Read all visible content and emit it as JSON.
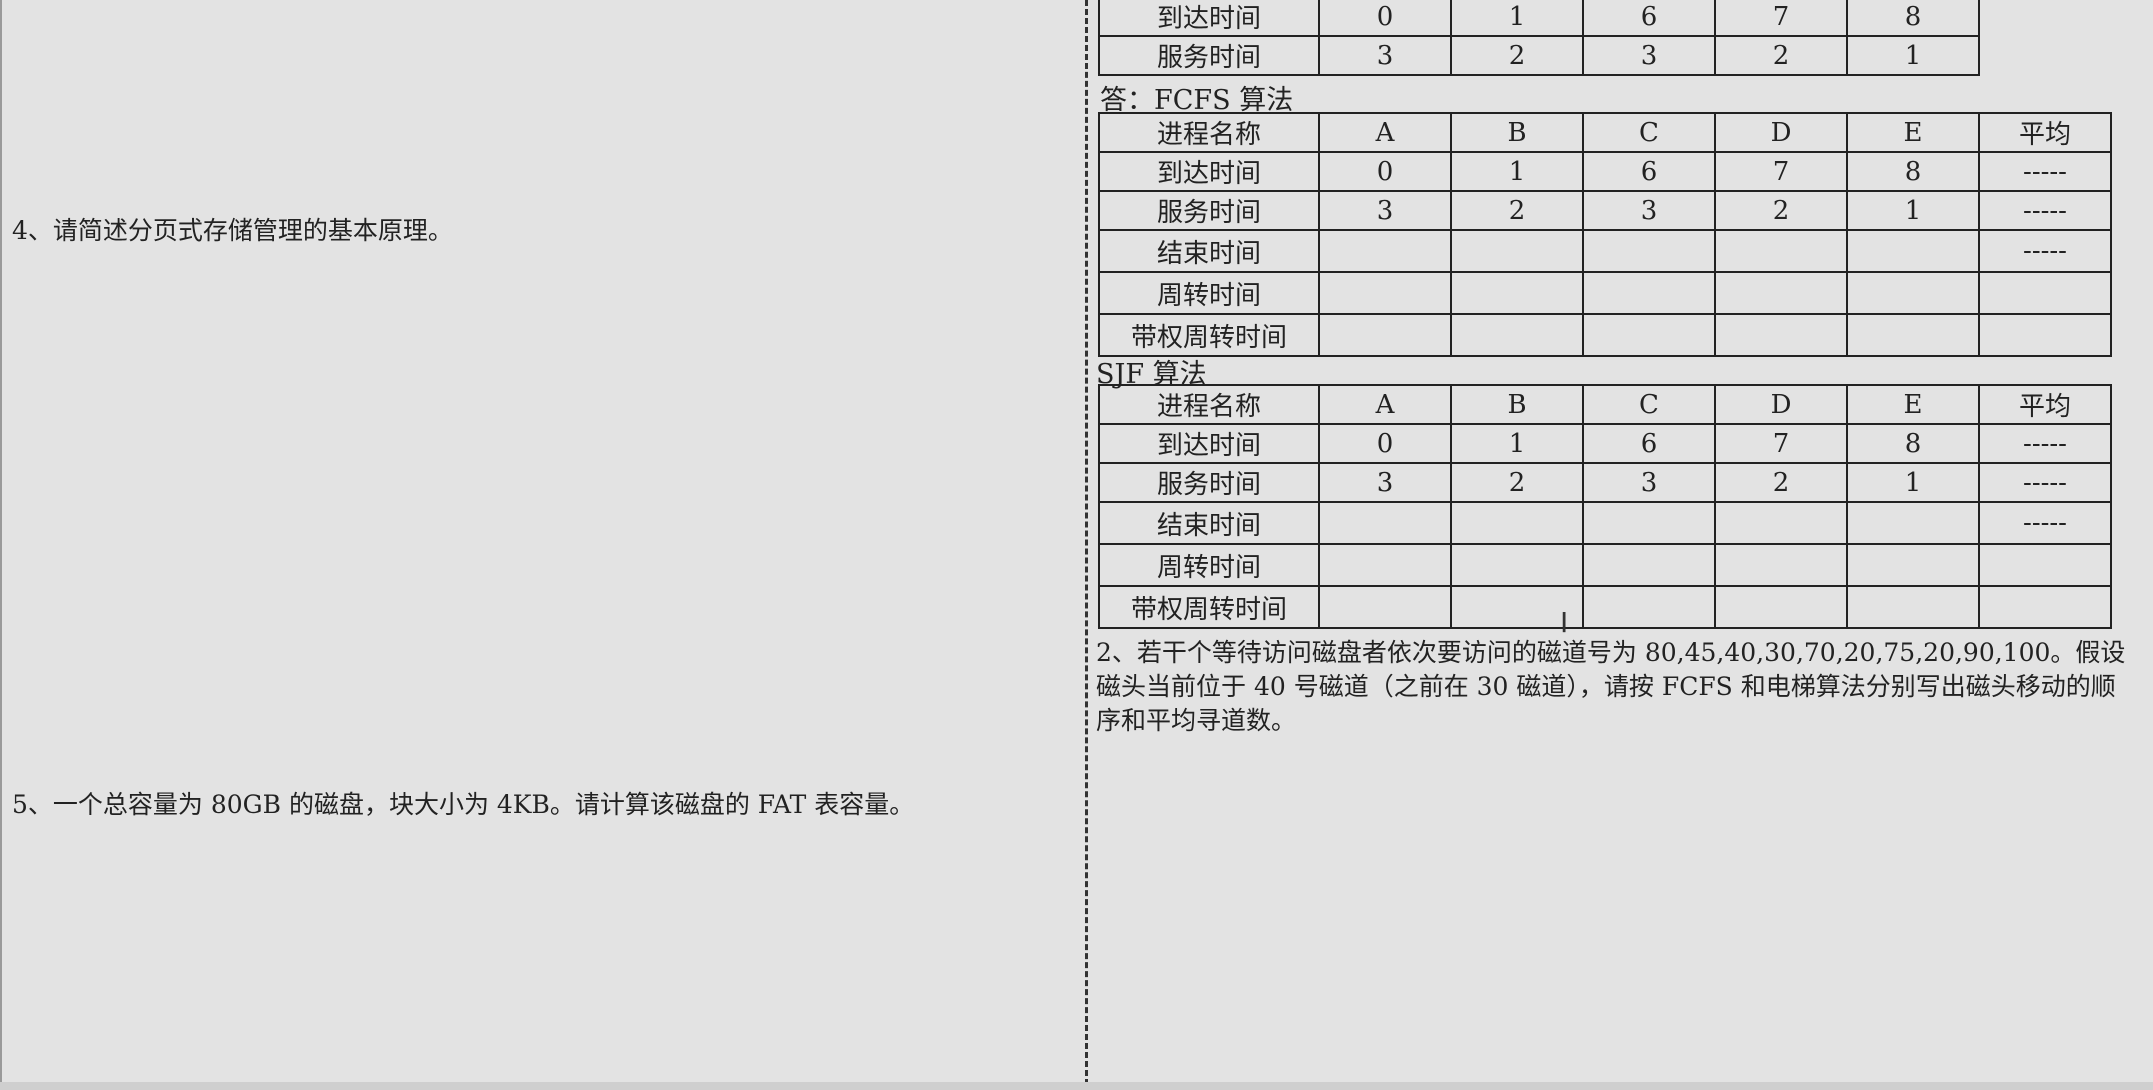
{
  "left": {
    "q4": "4、请简述分页式存储管理的基本原理。",
    "q5": "5、一个总容量为 80GB 的磁盘，块大小为 4KB。请计算该磁盘的 FAT 表容量。"
  },
  "right": {
    "top_table": {
      "arrive_label": "到达时间",
      "arrive": [
        "0",
        "1",
        "6",
        "7",
        "8"
      ],
      "service_label": "服务时间",
      "service": [
        "3",
        "2",
        "3",
        "2",
        "1"
      ]
    },
    "fcfs_label": "答：FCFS 算法",
    "sjf_label": "SJF 算法",
    "table": {
      "head": "进程名称",
      "processes": [
        "A",
        "B",
        "C",
        "D",
        "E"
      ],
      "avg": "平均",
      "dash": "-----",
      "arrive_label": "到达时间",
      "arrive": [
        "0",
        "1",
        "6",
        "7",
        "8"
      ],
      "service_label": "服务时间",
      "service": [
        "3",
        "2",
        "3",
        "2",
        "1"
      ],
      "finish_label": "结束时间",
      "turnaround_label": "周转时间",
      "weighted_label": "带权周转时间"
    },
    "q2": "2、若干个等待访问磁盘者依次要访问的磁道号为 80,45,40,30,70,20,75,20,90,100。假设磁头当前位于 40 号磁道（之前在 30 磁道），请按 FCFS 和电梯算法分别写出磁头移动的顺序和平均寻道数。"
  }
}
